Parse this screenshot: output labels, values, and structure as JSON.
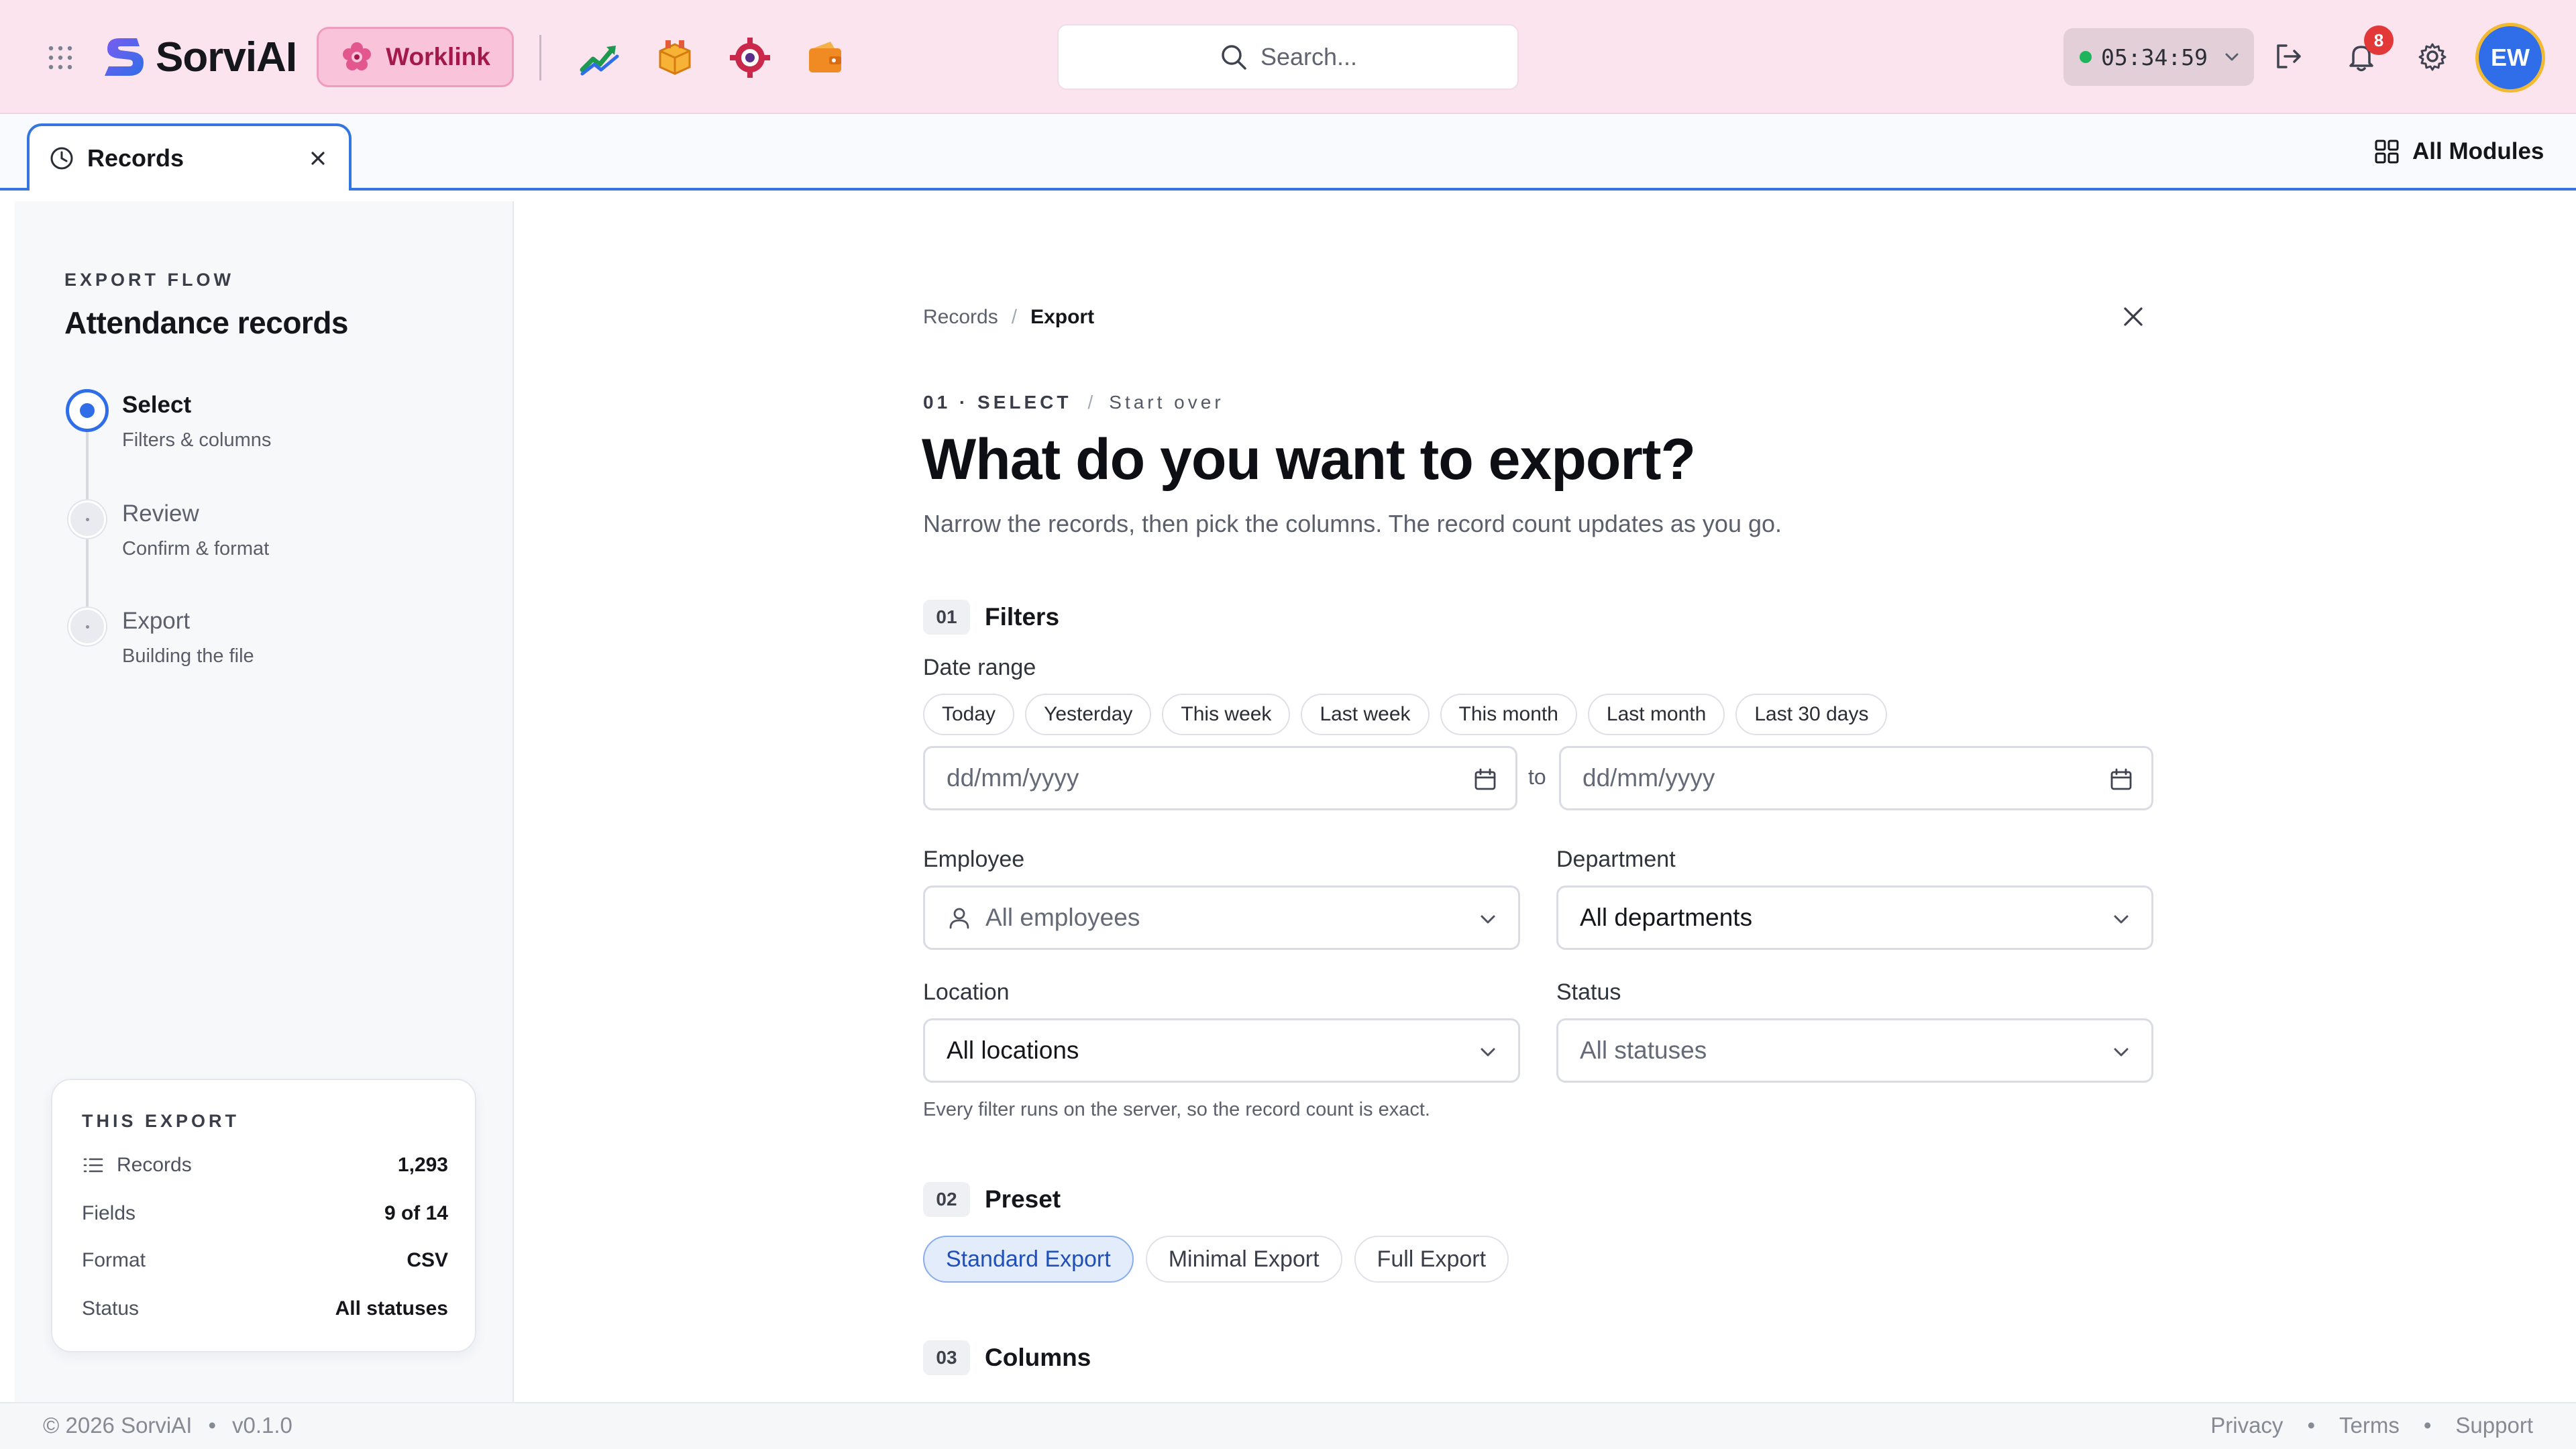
{
  "brand": {
    "name": "SorviAI",
    "product_chip": "Worklink"
  },
  "header": {
    "search_placeholder": "Search...",
    "timer": "05:34:59",
    "notifications_count": "8",
    "avatar_initials": "EW",
    "app_icons": [
      "chart-growth-icon",
      "package-icon",
      "gear-badge-icon",
      "wallet-icon"
    ]
  },
  "tabs": {
    "active_tab": "Records",
    "all_modules": "All Modules"
  },
  "sidebar": {
    "eyebrow": "EXPORT FLOW",
    "title": "Attendance records",
    "steps": [
      {
        "label": "Select",
        "sub": "Filters & columns",
        "state": "active"
      },
      {
        "label": "Review",
        "sub": "Confirm & format",
        "state": "pending"
      },
      {
        "label": "Export",
        "sub": "Building the file",
        "state": "pending"
      }
    ],
    "summary": {
      "eyebrow": "THIS EXPORT",
      "records_label": "Records",
      "records_value": "1,293",
      "fields_label": "Fields",
      "fields_value": "9 of 14",
      "format_label": "Format",
      "format_value": "CSV",
      "status_label": "Status",
      "status_value": "All statuses"
    }
  },
  "main": {
    "breadcrumb": {
      "parent": "Records",
      "sep": "/",
      "current": "Export"
    },
    "eyebrow": {
      "step": "01 · SELECT",
      "sep": "/",
      "link": "Start over"
    },
    "title": "What do you want to export?",
    "lead": "Narrow the records, then pick the columns. The record count updates as you go.",
    "filters": {
      "num": "01",
      "title": "Filters",
      "date_range_label": "Date range",
      "quick_ranges": [
        "Today",
        "Yesterday",
        "This week",
        "Last week",
        "This month",
        "Last month",
        "Last 30 days"
      ],
      "date_from_placeholder": "dd/mm/yyyy",
      "date_to_placeholder": "dd/mm/yyyy",
      "to_label": "to",
      "employee_label": "Employee",
      "employee_value": "All employees",
      "department_label": "Department",
      "department_value": "All departments",
      "location_label": "Location",
      "location_value": "All locations",
      "status_label": "Status",
      "status_value": "All statuses",
      "hint": "Every filter runs on the server, so the record count is exact."
    },
    "preset": {
      "num": "02",
      "title": "Preset",
      "options": [
        "Standard Export",
        "Minimal Export",
        "Full Export"
      ],
      "selected": "Standard Export"
    },
    "columns": {
      "num": "03",
      "title": "Columns"
    }
  },
  "footer": {
    "copyright": "© 2026 SorviAI",
    "dot": "•",
    "version": "v0.1.0",
    "links": [
      "Privacy",
      "Terms",
      "Support"
    ]
  },
  "colors": {
    "accent": "#2f6ee8",
    "header_bg": "#fce4ef",
    "brand_pink": "#a3184d"
  }
}
